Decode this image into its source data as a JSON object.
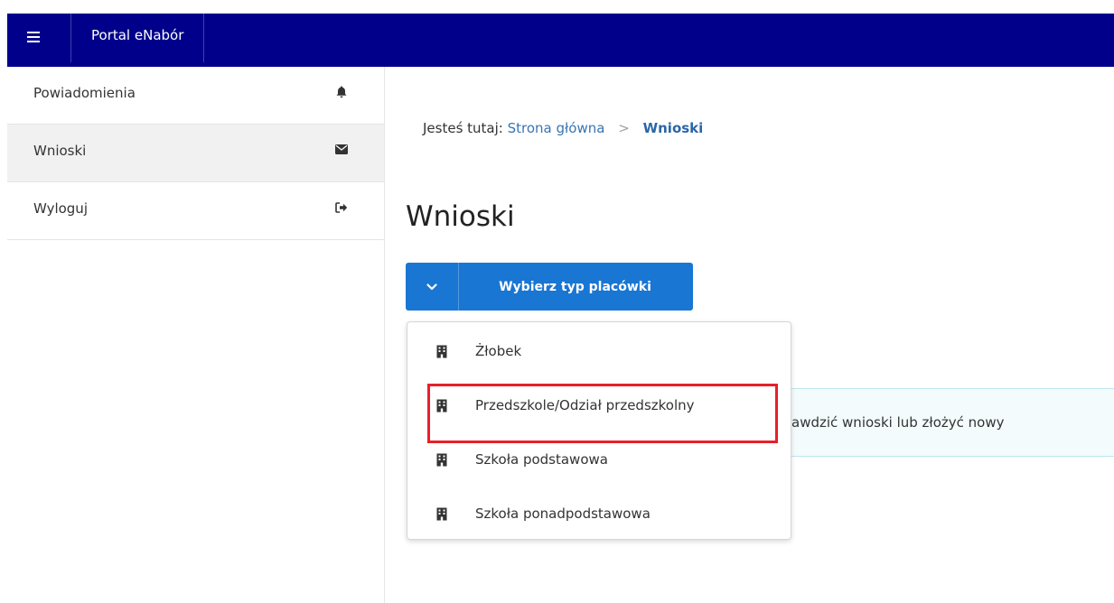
{
  "topbar": {
    "brand": "Portal eNabór",
    "bg_color": "#00008b"
  },
  "sidebar": {
    "items": [
      {
        "label": "Powiadomienia",
        "icon": "bell-icon"
      },
      {
        "label": "Wnioski",
        "icon": "envelope-icon",
        "active": true
      },
      {
        "label": "Wyloguj",
        "icon": "sign-out-icon"
      }
    ]
  },
  "breadcrumb": {
    "prefix": "Jesteś tutaj:",
    "home": "Strona główna",
    "separator": ">",
    "current": "Wnioski"
  },
  "main": {
    "title": "Wnioski",
    "dropdown_label": "Wybierz typ placówki",
    "accent_color": "#1976d2",
    "info_text": "awdzić wnioski lub złożyć nowy"
  },
  "menu": {
    "items": [
      {
        "label": "Żłobek",
        "icon": "building-icon"
      },
      {
        "label": "Przedszkole/Odział przedszkolny",
        "icon": "building-icon",
        "highlighted": true
      },
      {
        "label": "Szkoła podstawowa",
        "icon": "building-icon"
      },
      {
        "label": "Szkoła ponadpodstawowa",
        "icon": "building-icon"
      }
    ],
    "highlight_color": "#e8202a"
  }
}
